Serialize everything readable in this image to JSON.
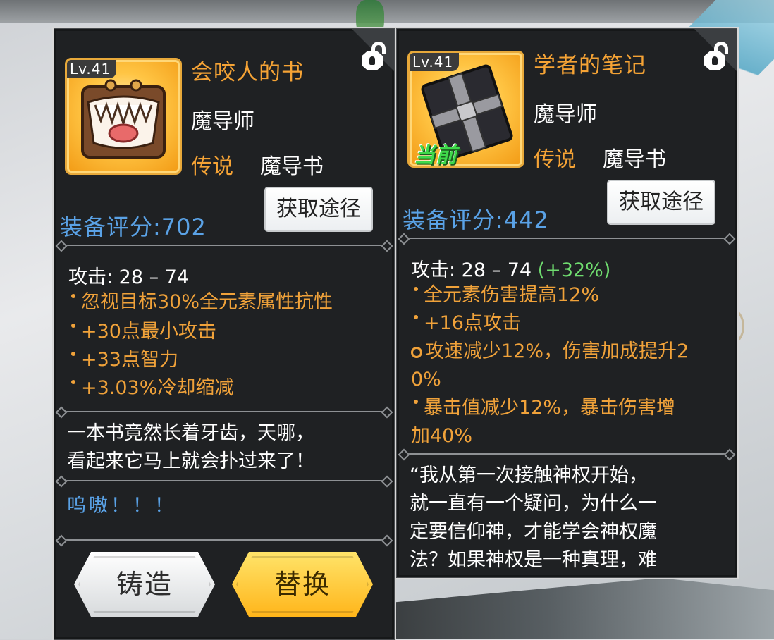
{
  "left_item": {
    "level": "Lv.41",
    "name": "会咬人的书",
    "class": "魔导师",
    "rarity": "传说",
    "type": "魔导书",
    "source_button": "获取途径",
    "score": "装备评分:702",
    "attack": "攻击: 28 – 74",
    "attributes": [
      "忽视目标30%全元素属性抗性",
      "+30点最小攻击",
      "+33点智力",
      "+3.03%冷却缩减"
    ],
    "description": "一本书竟然长着牙齿，天哪，\n看起来它马上就会扑过来了！",
    "sound": "呜嗷！！！",
    "forge_button": "铸造",
    "replace_button": "替换"
  },
  "right_item": {
    "level": "Lv.41",
    "current_tag": "当前",
    "name": "学者的笔记",
    "class": "魔导师",
    "rarity": "传说",
    "type": "魔导书",
    "source_button": "获取途径",
    "score": "装备评分:442",
    "attack": "攻击: 28 – 74",
    "attack_bonus": "(+32%)",
    "attributes": [
      "全元素伤害提高12%",
      "+16点攻击",
      "攻速减少12%，伤害加成提升2\n0%",
      "暴击值减少12%，暴击伤害增\n加40%"
    ],
    "description": "“我从第一次接触神权开始，\n就一直有一个疑问，为什么一\n定要信仰神，才能学会神权魔\n法？如果神权是一种真理，难"
  },
  "colors": {
    "orange": "#f5a335",
    "blue": "#5aa2e6",
    "green": "#6fdc6f",
    "panel": "#1f2123"
  }
}
